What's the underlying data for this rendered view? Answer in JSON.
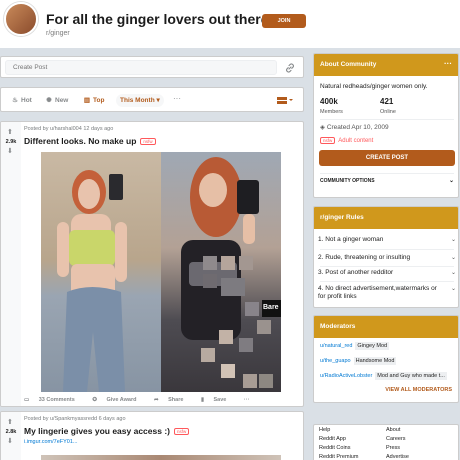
{
  "header": {
    "title": "For all the ginger lovers out there",
    "subreddit": "r/ginger",
    "join_label": "JOIN"
  },
  "create_post": {
    "placeholder": "Create Post"
  },
  "sort": {
    "hot": "Hot",
    "new": "New",
    "top": "Top",
    "time": "This Month",
    "time_chevron": "▾",
    "more": "···"
  },
  "posts": [
    {
      "score": "2.9k",
      "meta": "Posted by u/harshal004 12 days ago",
      "title": "Different looks. No make up",
      "nsfw": "nsfw",
      "watermark": "Bare",
      "actions": {
        "comments": "33 Comments",
        "award": "Give Award",
        "share": "Share",
        "save": "Save",
        "more": "···"
      }
    },
    {
      "score": "2.8k",
      "meta": "Posted by u/Spankmyassredd 6 days ago",
      "title": "My lingerie gives you easy access :)",
      "nsfw": "nsfw",
      "link": "i.imgur.com/7eFY01..."
    }
  ],
  "about": {
    "title": "About Community",
    "description": "Natural redheads/ginger women only.",
    "members_count": "400k",
    "members_label": "Members",
    "online_count": "421",
    "online_label": "Online",
    "created": "Created Apr 10, 2009",
    "nsfw_tag": "nsfw",
    "adult_label": "Adult content",
    "create_post_btn": "CREATE POST",
    "community_options": "COMMUNITY OPTIONS"
  },
  "rules": {
    "title": "r/ginger Rules",
    "items": [
      {
        "label": "1. Not a ginger woman"
      },
      {
        "label": "2. Rude, threatening or insulting"
      },
      {
        "label": "3. Post of another redditor"
      },
      {
        "label": "4. No direct advertisement,watermarks or for profit links"
      }
    ]
  },
  "moderators": {
    "title": "Moderators",
    "list": [
      {
        "user": "u/natural_red",
        "flair": "Gingey Mod"
      },
      {
        "user": "u/the_guapo",
        "flair": "Handsome Mod"
      },
      {
        "user": "u/RadioActiveLobster",
        "flair": "Mod and Guy who made t..."
      }
    ],
    "view_all": "VIEW ALL MODERATORS"
  },
  "footer": {
    "col1": [
      "Help",
      "Reddit App",
      "Reddit Coins",
      "Reddit Premium"
    ],
    "col2": [
      "About",
      "Careers",
      "Press",
      "Advertise"
    ]
  },
  "colors": {
    "accent": "#b25b1c",
    "card_header": "#d0981c",
    "nsfw": "#ff585b",
    "link": "#0079d3"
  }
}
